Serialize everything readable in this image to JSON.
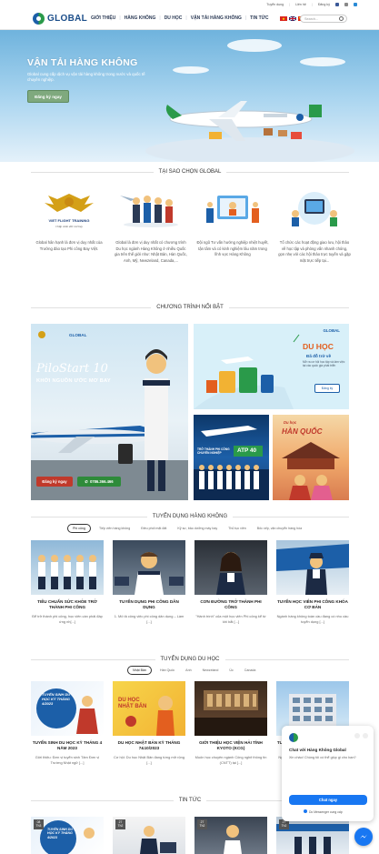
{
  "topbar": {
    "items": [
      "Tuyển dụng",
      "Liên hệ",
      "Đăng ký"
    ]
  },
  "header": {
    "logo": "GLOBAL",
    "nav": [
      "GIỚI THIỆU",
      "HÀNG KHÔNG",
      "DU HỌC",
      "VẬN TẢI HÀNG KHÔNG",
      "TIN TỨC"
    ],
    "search_placeholder": "Search..."
  },
  "hero": {
    "title": "VẬN TẢI HÀNG KHÔNG",
    "description": "Global cung cấp dịch vụ vận tải hàng không trong nước và quốc tế chuyên nghiệp.",
    "button": "Đăng ký ngay"
  },
  "why": {
    "heading": "TẠI SAO CHỌN GLOBAL",
    "badge": "VIET FLIGHT TRAINING",
    "badge_tagline": "Chắp cánh ước mơ bay",
    "cards": [
      {
        "text": "Global hân hạnh là đơn vị duy nhất của Trường đào tạo Phi công Bay Việt."
      },
      {
        "text": "Global là đơn vị duy nhất có chương trình Du học ngành Hàng Không ở nhiều Quốc gia trên thế giới như: Nhật Bản, Hàn Quốc, Anh, Mỹ, Newzeland, Canada,..."
      },
      {
        "text": "Đội ngũ Tư vấn hướng nghiệp nhiệt huyết, tận tâm và có kinh nghiệm lâu năm trong lĩnh vực Hàng Không"
      },
      {
        "text": "Tổ chức các hoạt động giao lưu, hội thảo về học tập và phỏng vấn nhanh chóng, gọn nhẹ với các hội thảo trực tuyến và gặp mặt trực tiếp tại..."
      }
    ]
  },
  "programs": {
    "heading": "CHƯƠNG TRÌNH NỔI BẬT",
    "pilot": {
      "brand": "GLOBAL",
      "title": "PiloStart 10",
      "subtitle": "KHỞI NGUỒN ƯỚC MƠ BAY",
      "register": "Đăng ký ngay",
      "phone": "0786.366.466"
    },
    "duhoc": {
      "brand": "GLOBAL",
      "title": "DU HỌC",
      "subtitle": "Đã đỗ trở về",
      "desc": "Mở ra cơ hội học tập và làm việc tại các quốc gia phát triển",
      "button": "Đăng ký"
    },
    "atp": {
      "label": "TRỞ THÀNH PHI CÔNG CHUYÊN NGHIỆP",
      "badge": "ATP 40"
    },
    "hq": {
      "pre": "Du học",
      "title": "HÀN QUỐC"
    }
  },
  "aviation_jobs": {
    "heading": "TUYỂN DỤNG HÀNG KHÔNG",
    "tabs": [
      "Phi công",
      "Tiếp viên hàng không",
      "Điều phối mặt đất",
      "Kỹ sư, bảo dưỡng máy bay",
      "Thủ tục viên",
      "Bốc xếp, vận chuyển hàng hóa"
    ],
    "cards": [
      {
        "title": "TIÊU CHUẨN SỨC KHỎE TRỞ THÀNH PHI CÔNG",
        "desc": "Để trở thành phi công, học viên cần phải đáp ứng nh[...]"
      },
      {
        "title": "TUYỂN DỤNG PHI CÔNG DÂN DỤNG",
        "desc": "1. Mô tả công việc phi công dân dụng – Làm [...]"
      },
      {
        "title": "CƠN ĐƯỜNG TRỞ THÀNH PHI CÔNG",
        "desc": "\"Hành trình\" của một học viên Phi công kể từ khi bắt [...]"
      },
      {
        "title": "TUYỂN HỌC VIÊN PHI CÔNG KHÓA CƠ BẢN",
        "desc": "Ngành hàng không toàn cầu đang có nhu cầu tuyển dụng [...]"
      }
    ]
  },
  "study_abroad": {
    "heading": "TUYỂN DỤNG DU HỌC",
    "tabs": [
      "Nhật Bản",
      "Hàn Quốc",
      "Anh",
      "Newzeland",
      "Úc",
      "Canada"
    ],
    "cards": [
      {
        "title": "TUYỂN SINH DU HỌC KỲ THÁNG 4 NĂM 2023",
        "desc": "Giới thiệu: Đơn vị tuyển sinh Tâm Đơn vị Trường Nhật ngữ [...]",
        "img_text": "TUYỂN SINH DU HỌC KỲ THÁNG 4/2023"
      },
      {
        "title": "DU HỌC NHẬT BẢN KỲ THÁNG 7&10/2023",
        "desc": "Cơ hội: Du học Nhật Bản đang từng mở rộng [...]",
        "img_text": "DU HỌC NHẬT BẢN"
      },
      {
        "title": "GIỚI THIỆU HỌC VIỆN HẢI TÍNH KYOTO (KCG)",
        "desc": "Muốn học chuyên ngành Công nghệ thông tin (CNTT) tại [...]"
      },
      {
        "title": "TUYỂN SINH DU HỌC HỌC VIỆN KỸ THUẬT TOKYO",
        "desc": "Ngành du học sinh Nhật Bản ngày càng [...]"
      }
    ]
  },
  "news": {
    "heading": "TIN TỨC",
    "cards": [
      {
        "day": "08",
        "month": "Th3",
        "img_text": "TUYỂN SINH DU HỌC KỲ THÁNG 4/2023"
      },
      {
        "day": "27",
        "month": "Th2"
      },
      {
        "day": "27",
        "month": "Th2"
      },
      {
        "day": "27",
        "month": "Th2"
      }
    ]
  },
  "chat": {
    "title": "Chat với Hàng Không Global",
    "message": "Xin chào! Chúng tôi có thể giúp gì cho bạn?",
    "button": "Chat ngay",
    "footer": "Do Messenger cung cấp"
  },
  "colors": {
    "primary": "#1c5fa8",
    "accent_green": "#2e8b3a",
    "cta_red": "#c0392b",
    "messenger": "#1877f2"
  }
}
